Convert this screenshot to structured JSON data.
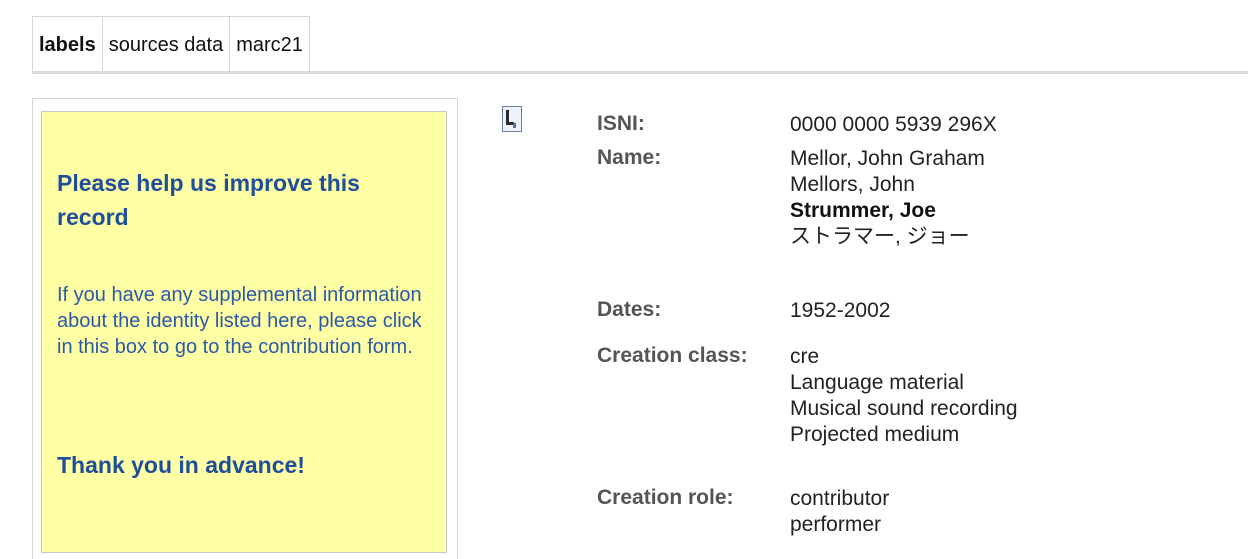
{
  "tabs": [
    {
      "label": "labels",
      "active": true
    },
    {
      "label": "sources data",
      "active": false
    },
    {
      "label": "marc21",
      "active": false
    }
  ],
  "help_box": {
    "title": "Please help us improve this record",
    "text": "If you have any supplemental information about the identity listed here, please click in this box to go to the contribution form.",
    "thanks": "Thank you in advance!"
  },
  "record": {
    "icon": "record-icon",
    "isni_label": "ISNI:",
    "isni_value": "0000 0000 5939 296X",
    "name_label": "Name:",
    "names": [
      "Mellor, John Graham",
      "Mellors, John",
      "Strummer, Joe",
      "ストラマー, ジョー"
    ],
    "dates_label": "Dates:",
    "dates_value": "1952-2002",
    "creation_class_label": "Creation class:",
    "creation_class": [
      "cre",
      "Language material",
      "Musical sound recording",
      "Projected medium"
    ],
    "creation_role_label": "Creation role:",
    "creation_role": [
      "contributor",
      "performer"
    ]
  },
  "colors": {
    "help_background": "#ffffa6",
    "help_title": "#1f4e9c",
    "help_text": "#2a59a8",
    "label": "#555555"
  }
}
